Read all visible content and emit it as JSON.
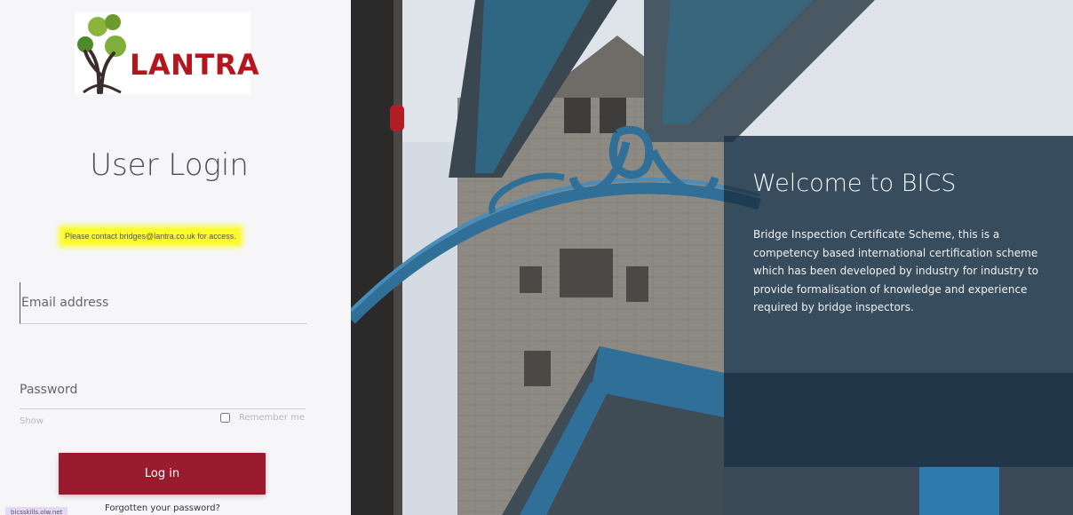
{
  "brand": {
    "name": "LANTRA",
    "tree_icon": "tree-logo-icon"
  },
  "login": {
    "title": "User Login",
    "contact_note": "Please contact bridges@lantra.co.uk for access.",
    "email_placeholder": "Email address",
    "password_placeholder": "Password",
    "show_label": "Show",
    "remember_label": "Remember me",
    "login_button_label": "Log in",
    "forgot_label": "Forgotten your password?",
    "footer_tag": "bicsskills.olw.net"
  },
  "welcome": {
    "title": "Welcome to BICS",
    "description": "Bridge Inspection Certificate Scheme, this is a competency based international certification scheme which has been developed by industry for industry to provide formalisation of knowledge and experience required by bridge inspectors."
  },
  "colors": {
    "login_button": "#9b1b2e",
    "brand_red": "#b4161d",
    "highlight": "#fbfb2a",
    "welcome_panel": "#1d3447"
  }
}
